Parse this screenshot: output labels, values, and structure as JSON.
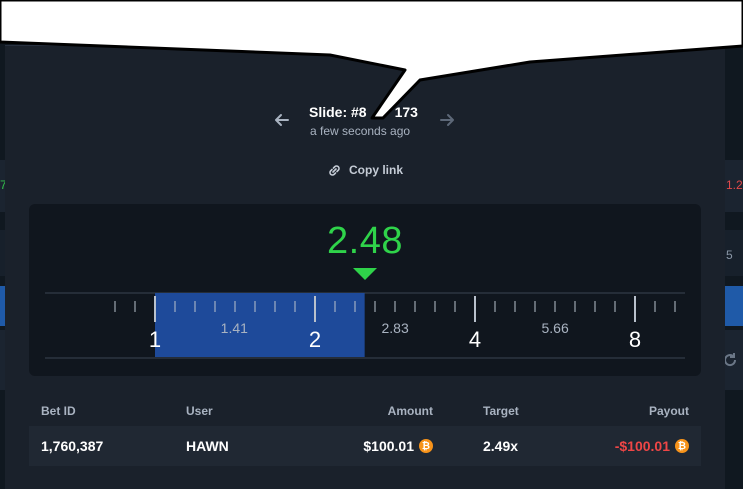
{
  "slide": {
    "title": "Slide: #8",
    "title_suffix": "173",
    "time": "a few seconds ago",
    "copy_link_label": "Copy link"
  },
  "result": {
    "value": "2.48",
    "multiplier": 2.48,
    "scale_labels": [
      "1",
      "1.41",
      "2",
      "2.83",
      "4",
      "5.66",
      "8"
    ],
    "scale_values": [
      1,
      1.41,
      2,
      2.83,
      4,
      5.66,
      8
    ],
    "major_labels": [
      "1",
      "2",
      "4",
      "8"
    ],
    "color": "#2fd34a",
    "range_color": "#1e4a9a"
  },
  "bets": {
    "columns": [
      "Bet ID",
      "User",
      "Amount",
      "Target",
      "Payout"
    ],
    "rows": [
      {
        "bet_id": "1,760,387",
        "user": "HAWN",
        "amount": "$100.01",
        "target": "2.49x",
        "payout": "-$100.01"
      }
    ],
    "currency_icon": "bitcoin-icon",
    "loss_color": "#ef4646"
  },
  "background": {
    "left_edge_text": "7",
    "right_edge_text": "1.2",
    "right_edge_text2": "5"
  }
}
